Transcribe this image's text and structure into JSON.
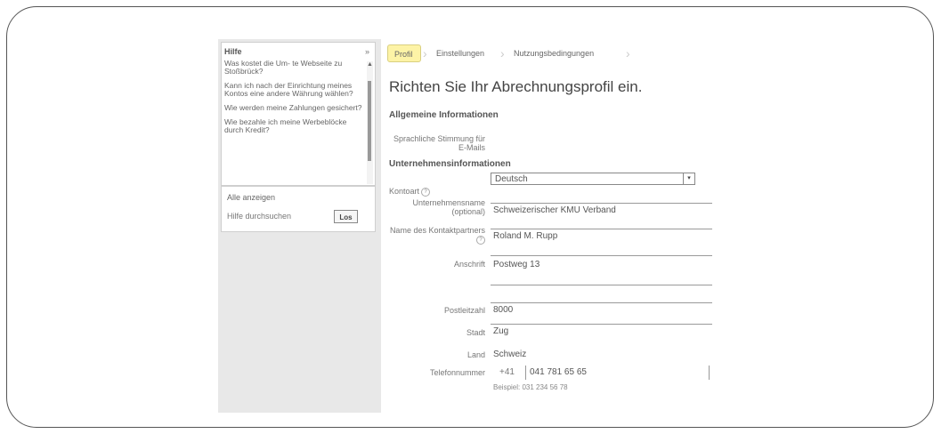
{
  "help": {
    "title": "Hilfe",
    "close": "»",
    "links": [
      "Was kostet die Um- te Webseite zu Stoßbrück?",
      "Kann ich nach der Einrichtung meines Kontos eine andere Währung wählen?",
      "Wie werden meine Zahlungen gesichert?",
      "Wie bezahle ich meine Werbeblöcke durch Kredit?"
    ],
    "all_label": "Alle anzeigen",
    "search_placeholder": "Hilfe durchsuchen",
    "go_label": "Los"
  },
  "steps": [
    "Profil",
    "Einstellungen",
    "Nutzungsbedingungen"
  ],
  "page_title": "Richten Sie Ihr Abrechnungsprofil ein.",
  "general_section": "Allgemeine Informationen",
  "language": {
    "label": "Sprachliche Stimmung für E-Mails",
    "value": "Deutsch"
  },
  "company_section": "Unternehmensinformationen",
  "fields": {
    "account_type_label": "Kontoart",
    "company_name_label": "Unternehmensname (optional)",
    "company_name_value": "Schweizerischer KMU Verband",
    "contact_label": "Name des Kontaktpartners",
    "contact_value": "Roland M. Rupp",
    "address_label": "Anschrift",
    "address_value": "Postweg 13",
    "zip_label": "Postleitzahl",
    "zip_value": "8000",
    "city_label": "Stadt",
    "city_value": "Zug",
    "country_label": "Land",
    "country_value": "Schweiz",
    "phone_label": "Telefonnummer",
    "phone_code": "+41",
    "phone_value": "041 781 65 65",
    "phone_example": "Beispiel: 031 234 56 78"
  }
}
